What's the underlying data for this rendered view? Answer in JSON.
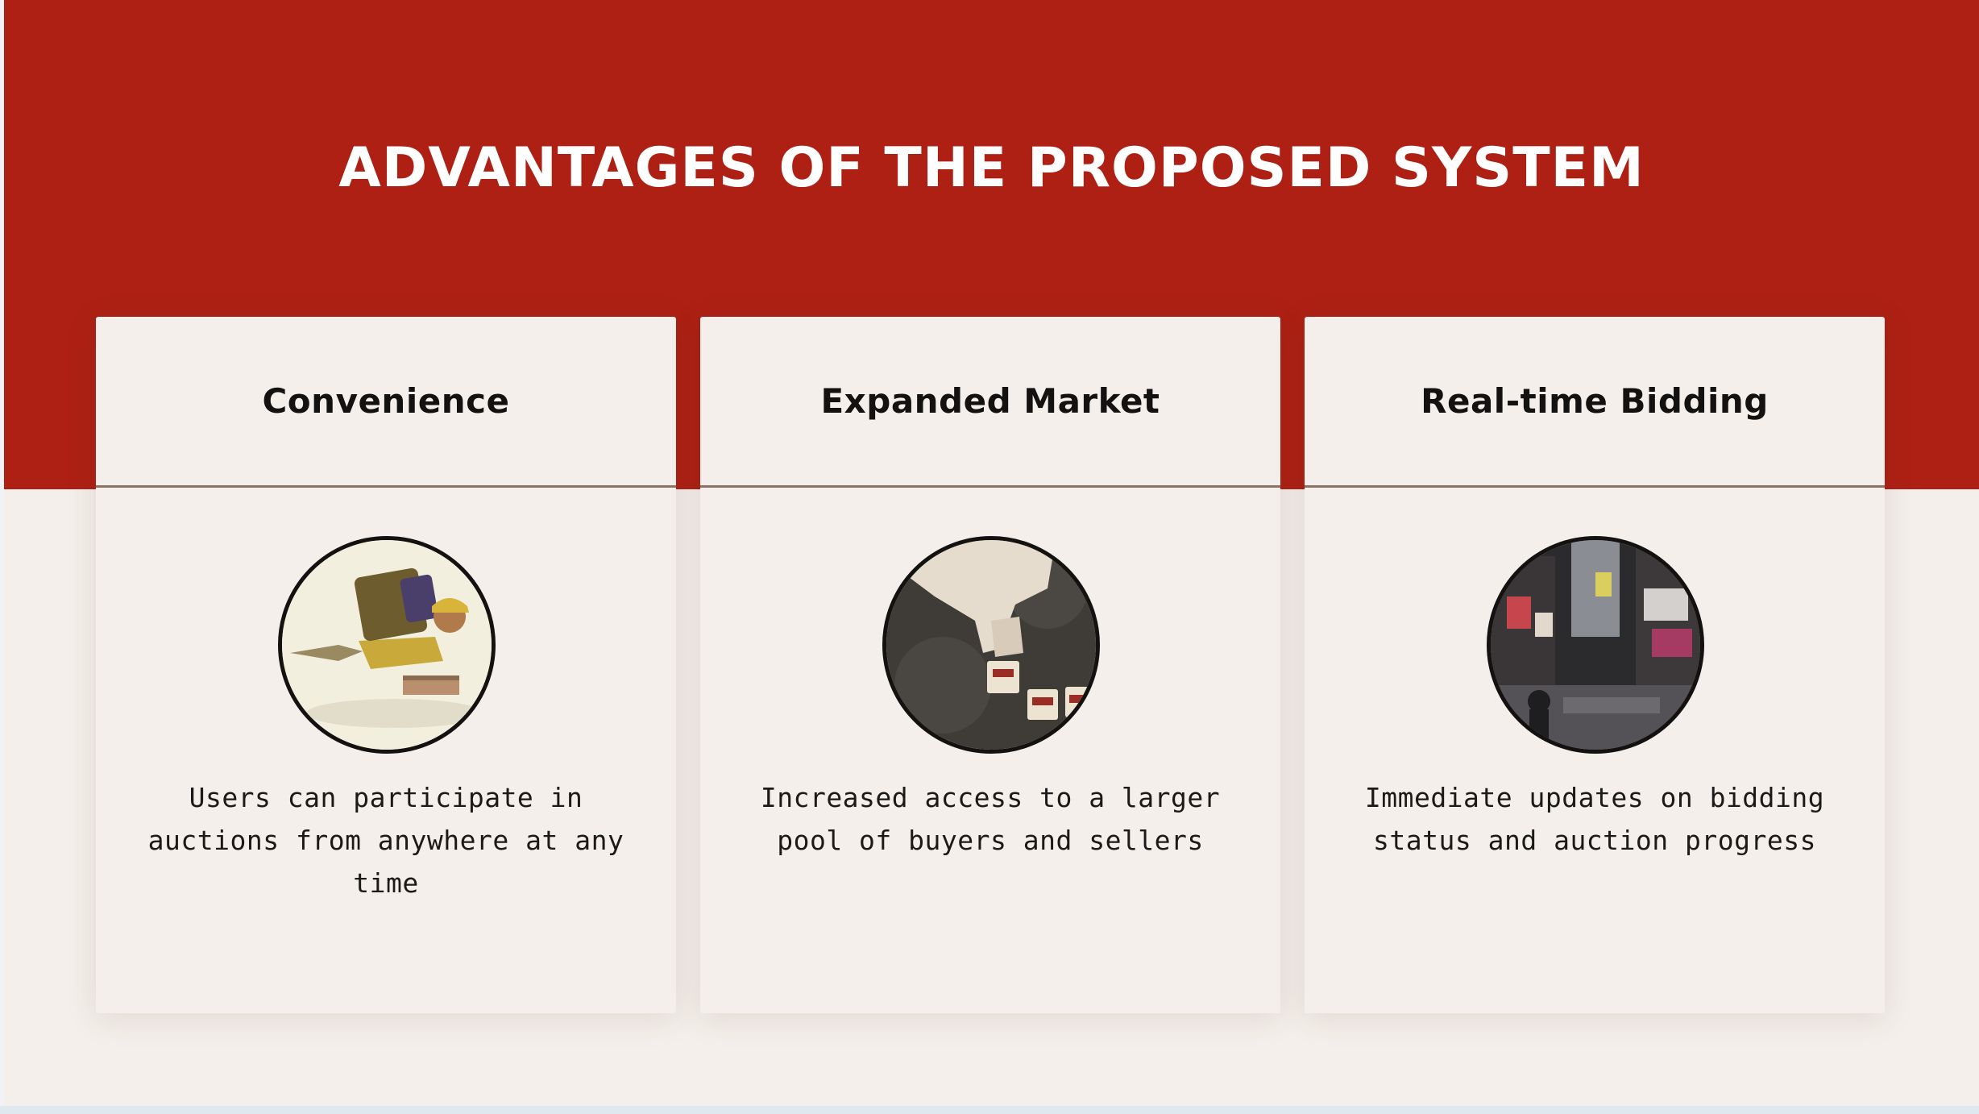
{
  "slide": {
    "title": "ADVANTAGES OF THE PROPOSED SYSTEM",
    "accent_color": "#ae2014",
    "background_color": "#f4efea"
  },
  "cards": [
    {
      "title": "Convenience",
      "image_icon": "flying-delivery-man-icon",
      "description": "Users can participate in auctions from anywhere at any time"
    },
    {
      "title": "Expanded Market",
      "image_icon": "hand-placing-store-blocks-icon",
      "description": "Increased access to a larger pool of buyers and sellers"
    },
    {
      "title": "Real-time Bidding",
      "image_icon": "city-billboards-icon",
      "description": "Immediate updates on bidding status and auction progress"
    }
  ]
}
